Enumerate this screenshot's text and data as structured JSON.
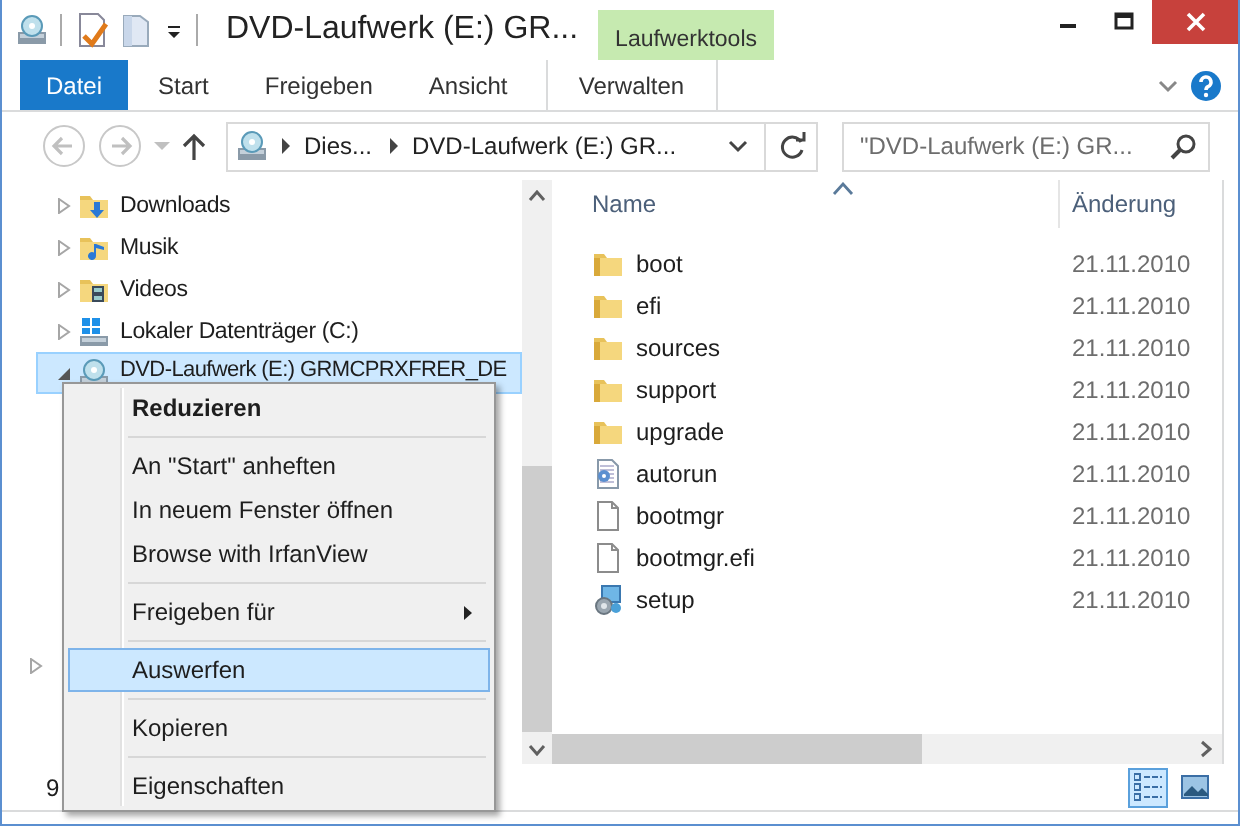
{
  "title_bar": {
    "title": "DVD-Laufwerk (E:) GR...",
    "context_tab": "Laufwerktools"
  },
  "ribbon_tabs": [
    {
      "label": "Datei",
      "kind": "file"
    },
    {
      "label": "Start",
      "kind": "tab"
    },
    {
      "label": "Freigeben",
      "kind": "tab"
    },
    {
      "label": "Ansicht",
      "kind": "tab"
    },
    {
      "label": "Verwalten",
      "kind": "contextual"
    }
  ],
  "address_bar": {
    "segments": [
      "Dies...",
      "DVD-Laufwerk (E:) GR..."
    ]
  },
  "search": {
    "placeholder": "\"DVD-Laufwerk (E:) GR..."
  },
  "nav_tree": {
    "items": [
      {
        "label": "Downloads",
        "kind": "downloads",
        "expanded": false,
        "selected": false
      },
      {
        "label": "Musik",
        "kind": "music",
        "expanded": false,
        "selected": false
      },
      {
        "label": "Videos",
        "kind": "videos",
        "expanded": false,
        "selected": false
      },
      {
        "label": "Lokaler Datenträger (C:)",
        "kind": "disk",
        "expanded": false,
        "selected": false
      },
      {
        "label": "DVD-Laufwerk (E:) GRMCPRXFRER_DE",
        "kind": "dvd",
        "expanded": true,
        "selected": true
      }
    ]
  },
  "file_list": {
    "columns": [
      {
        "label": "Name",
        "sorted": true
      },
      {
        "label": "Änderung",
        "sorted": false
      }
    ],
    "rows": [
      {
        "name": "boot",
        "kind": "folder",
        "modified": "21.11.2010"
      },
      {
        "name": "efi",
        "kind": "folder",
        "modified": "21.11.2010"
      },
      {
        "name": "sources",
        "kind": "folder",
        "modified": "21.11.2010"
      },
      {
        "name": "support",
        "kind": "folder",
        "modified": "21.11.2010"
      },
      {
        "name": "upgrade",
        "kind": "folder",
        "modified": "21.11.2010"
      },
      {
        "name": "autorun",
        "kind": "config",
        "modified": "21.11.2010"
      },
      {
        "name": "bootmgr",
        "kind": "file",
        "modified": "21.11.2010"
      },
      {
        "name": "bootmgr.efi",
        "kind": "file",
        "modified": "21.11.2010"
      },
      {
        "name": "setup",
        "kind": "setup",
        "modified": "21.11.2010"
      }
    ]
  },
  "status_bar": {
    "item_count": "9",
    "views": [
      {
        "kind": "details",
        "selected": true
      },
      {
        "kind": "large_icons",
        "selected": false
      }
    ]
  },
  "context_menu": {
    "groups": [
      [
        {
          "label": "Reduzieren",
          "default": true,
          "submenu": false,
          "selected": false
        }
      ],
      [
        {
          "label": "An \"Start\" anheften",
          "default": false,
          "submenu": false,
          "selected": false
        },
        {
          "label": "In neuem Fenster öffnen",
          "default": false,
          "submenu": false,
          "selected": false
        },
        {
          "label": "Browse with IrfanView",
          "default": false,
          "submenu": false,
          "selected": false
        }
      ],
      [
        {
          "label": "Freigeben für",
          "default": false,
          "submenu": true,
          "selected": false
        }
      ],
      [
        {
          "label": "Auswerfen",
          "default": false,
          "submenu": false,
          "selected": true
        }
      ],
      [
        {
          "label": "Kopieren",
          "default": false,
          "submenu": false,
          "selected": false
        }
      ],
      [
        {
          "label": "Eigenschaften",
          "default": false,
          "submenu": false,
          "selected": false
        }
      ]
    ]
  }
}
